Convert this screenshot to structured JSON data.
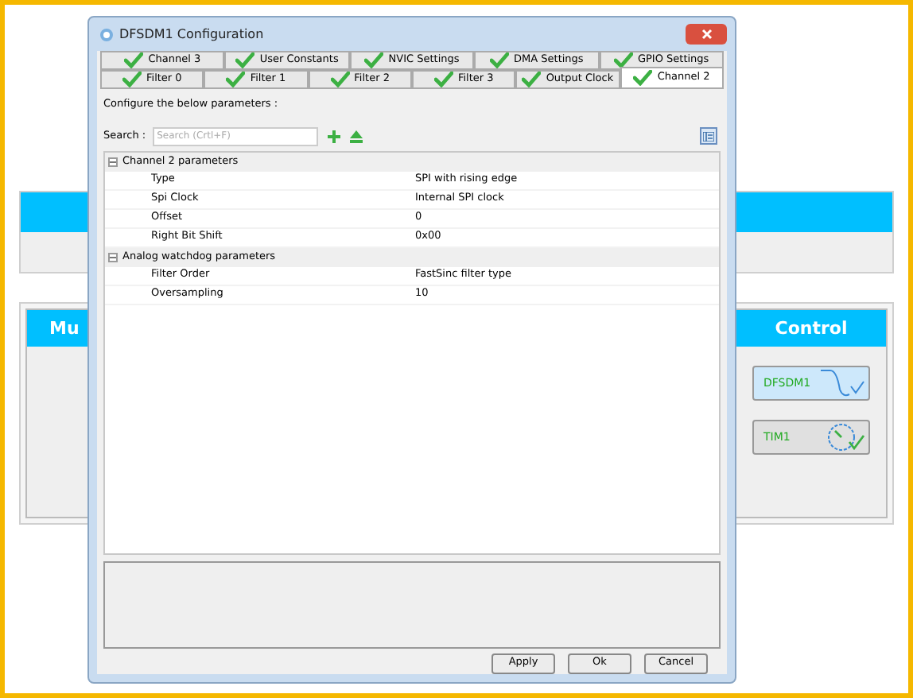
{
  "background": {
    "panels": [
      {
        "header": "Mu"
      },
      {
        "header": "Control"
      }
    ],
    "peripherals": [
      {
        "label": "DFSDM1",
        "kind": "filter",
        "selected": true
      },
      {
        "label": "TIM1",
        "kind": "timer",
        "selected": false
      }
    ]
  },
  "dialog": {
    "title": "DFSDM1 Configuration",
    "tab_rows": [
      [
        {
          "label": "Channel 3",
          "selected": false
        },
        {
          "label": "User Constants",
          "selected": false
        },
        {
          "label": "NVIC Settings",
          "selected": false
        },
        {
          "label": "DMA Settings",
          "selected": false
        },
        {
          "label": "GPIO Settings",
          "selected": false
        }
      ],
      [
        {
          "label": "Filter 0",
          "selected": false
        },
        {
          "label": "Filter 1",
          "selected": false
        },
        {
          "label": "Filter 2",
          "selected": false
        },
        {
          "label": "Filter 3",
          "selected": false
        },
        {
          "label": "Output Clock",
          "selected": false
        },
        {
          "label": "Channel 2",
          "selected": true
        }
      ]
    ],
    "instruction": "Configure the below parameters :",
    "search": {
      "label": "Search :",
      "placeholder": "Search (Crtl+F)"
    },
    "groups": [
      {
        "title": "Channel 2 parameters",
        "expanded": true,
        "rows": [
          {
            "name": "Type",
            "value": "SPI with rising edge"
          },
          {
            "name": "Spi Clock",
            "value": "Internal SPI clock"
          },
          {
            "name": "Offset",
            "value": "0"
          },
          {
            "name": "Right Bit Shift",
            "value": "0x00"
          }
        ]
      },
      {
        "title": "Analog watchdog parameters",
        "expanded": true,
        "rows": [
          {
            "name": "Filter Order",
            "value": "FastSinc filter type"
          },
          {
            "name": "Oversampling",
            "value": "10"
          }
        ]
      }
    ],
    "buttons": [
      "Apply",
      "Ok",
      "Cancel"
    ]
  }
}
